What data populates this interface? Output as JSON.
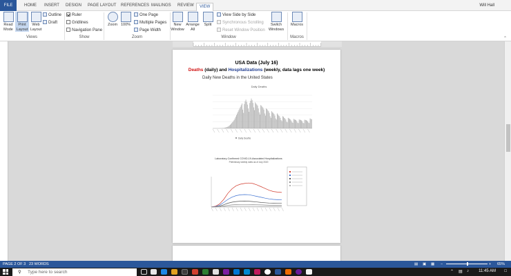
{
  "tabs": [
    "FILE",
    "HOME",
    "INSERT",
    "DESIGN",
    "PAGE LAYOUT",
    "REFERENCES",
    "MAILINGS",
    "REVIEW",
    "VIEW"
  ],
  "user_name": "Will Hall",
  "ribbon": {
    "views": {
      "label": "Views",
      "read_mode": [
        "Read",
        "Mode"
      ],
      "print_layout": [
        "Print",
        "Layout"
      ],
      "web_layout": [
        "Web",
        "Layout"
      ],
      "outline": "Outline",
      "draft": "Draft"
    },
    "show": {
      "label": "Show",
      "ruler": "Ruler",
      "gridlines": "Gridlines",
      "navigation_pane": "Navigation Pane",
      "ruler_checked": true,
      "gridlines_checked": false,
      "navigation_checked": false
    },
    "zoom": {
      "label": "Zoom",
      "zoom": "Zoom",
      "hundred": "100%",
      "one_page": "One Page",
      "multiple_pages": "Multiple Pages",
      "page_width": "Page Width"
    },
    "window": {
      "label": "Window",
      "new_window": [
        "New",
        "Window"
      ],
      "arrange_all": [
        "Arrange",
        "All"
      ],
      "split": "Split",
      "view_side_by_side": "View Side by Side",
      "synchronous_scrolling": "Synchronous Scrolling",
      "reset_window_position": "Reset Window Position",
      "switch_windows": [
        "Switch",
        "Windows"
      ]
    },
    "macros": {
      "label": "Macros",
      "macros": "Macros"
    }
  },
  "document": {
    "title": "USA Data (July 16)",
    "subtitle_deaths": "Deaths",
    "subtitle_mid": " (daily) and ",
    "subtitle_hosp": "Hospitalizations",
    "subtitle_end": " (weekly, data lags one week)",
    "caption": "Daily New Deaths in the United States"
  },
  "chart_data": [
    {
      "type": "bar",
      "title": "Daily Deaths",
      "subtitle": "",
      "ylabel": "",
      "legend": [
        "Daily Deaths"
      ],
      "values": [
        0,
        0,
        0,
        0,
        0,
        1,
        1,
        2,
        3,
        5,
        8,
        12,
        18,
        25,
        35,
        50,
        70,
        95,
        120,
        150,
        200,
        260,
        320,
        400,
        480,
        560,
        650,
        760,
        900,
        1050,
        1200,
        1350,
        1500,
        1650,
        1800,
        1950,
        2100,
        2250,
        1700,
        1400,
        2200,
        2450,
        2600,
        2400,
        2150,
        1800,
        1500,
        2300,
        2500,
        2700,
        2550,
        2300,
        1900,
        1650,
        2350,
        2250,
        2150,
        2050,
        1800,
        1450,
        1250,
        2100,
        2050,
        1950,
        1850,
        1700,
        1350,
        1150,
        1800,
        1750,
        1650,
        1550,
        1400,
        1100,
        950,
        1550,
        1450,
        1400,
        1300,
        1150,
        900,
        800,
        1350,
        1250,
        1150,
        1100,
        950,
        750,
        650,
        1100,
        1050,
        950,
        900,
        800,
        600,
        550,
        950,
        900,
        850,
        800,
        700,
        550,
        500,
        850,
        800,
        780,
        750,
        650,
        520,
        480,
        800,
        780,
        760,
        720,
        640,
        500,
        470,
        780,
        760,
        740,
        700,
        620,
        520,
        480,
        900,
        850,
        820
      ]
    },
    {
      "type": "line",
      "title": "Laboratory-Confirmed COVID-19-Associated Hospitalizations",
      "subtitle": "Preliminary weekly rates as of July 2020",
      "series": [
        {
          "name": "",
          "values": [
            0.1,
            0.5,
            2,
            5,
            9,
            12,
            14,
            15,
            15.5,
            15.8,
            15.5,
            14.6,
            13.4,
            12.2,
            11,
            10.2,
            9.8,
            9.6
          ]
        },
        {
          "name": "",
          "values": [
            0.05,
            0.3,
            1.2,
            3,
            5,
            6.5,
            7.5,
            8,
            8.2,
            8.1,
            7.6,
            7,
            6.4,
            5.8,
            5.3,
            5,
            4.8,
            4.7
          ]
        },
        {
          "name": "",
          "values": [
            0.03,
            0.2,
            0.6,
            1.5,
            2.5,
            3.2,
            3.6,
            3.8,
            3.9,
            3.8,
            3.6,
            3.3,
            3,
            2.8,
            2.6,
            2.5,
            2.4,
            2.4
          ]
        },
        {
          "name": "",
          "values": [
            0.01,
            0.1,
            0.3,
            0.7,
            1.1,
            1.4,
            1.6,
            1.7,
            1.7,
            1.7,
            1.6,
            1.5,
            1.4,
            1.3,
            1.2,
            1.2,
            1.1,
            1.1
          ]
        },
        {
          "name": "",
          "values": [
            0.01,
            0.05,
            0.1,
            0.2,
            0.3,
            0.4,
            0.5,
            0.5,
            0.5,
            0.5,
            0.5,
            0.5,
            0.4,
            0.4,
            0.4,
            0.4,
            0.4,
            0.4
          ]
        }
      ],
      "colors": [
        "#d0392b",
        "#3a6fd0",
        "#555555",
        "#8a8a8a",
        "#b0b0b0"
      ],
      "legend_entries": 5
    }
  ],
  "status": {
    "page": "PAGE 2 OF 3",
    "words": "23 WORDS",
    "zoom_level": "65%"
  },
  "taskbar": {
    "search_placeholder": "Type here to search",
    "time": "11:45 AM"
  },
  "colors": {
    "word_blue": "#2b579a",
    "deaths_red": "#d01010",
    "hosp_blue": "#1f3c8f"
  }
}
